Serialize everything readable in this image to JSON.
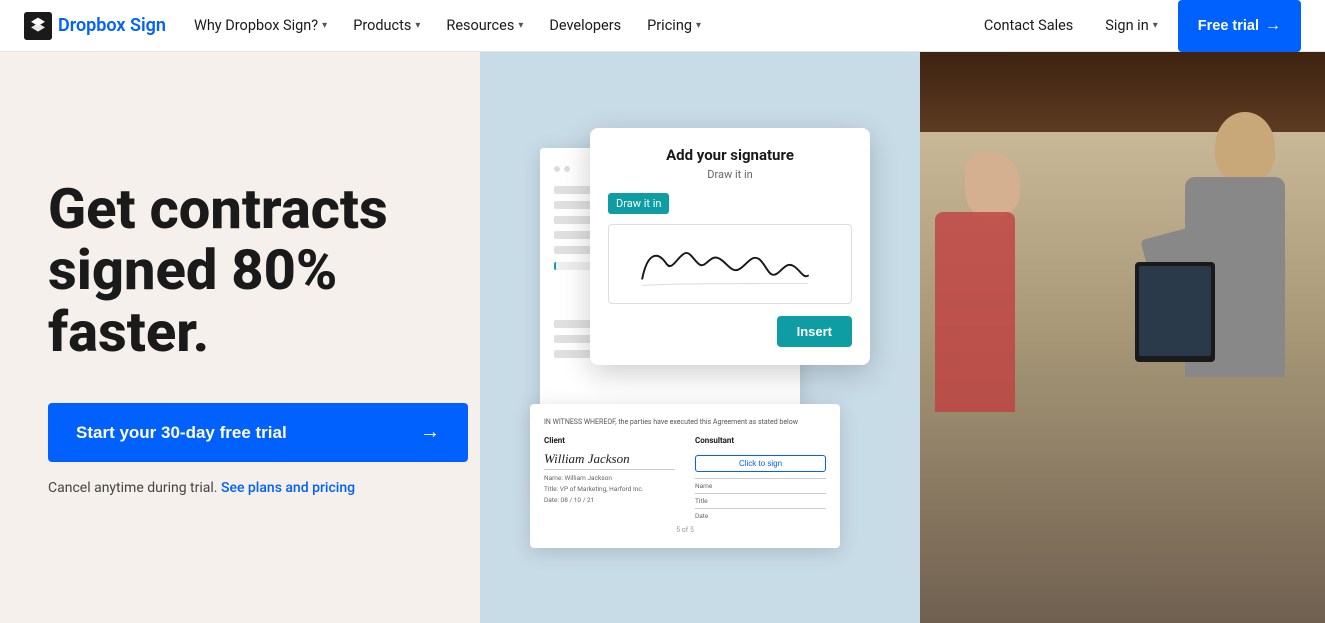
{
  "brand": {
    "name_part1": "Dropbox",
    "name_part2": "Sign"
  },
  "nav": {
    "items": [
      {
        "label": "Why Dropbox Sign?",
        "has_dropdown": true
      },
      {
        "label": "Products",
        "has_dropdown": true
      },
      {
        "label": "Resources",
        "has_dropdown": true
      },
      {
        "label": "Developers",
        "has_dropdown": false
      },
      {
        "label": "Pricing",
        "has_dropdown": true
      }
    ],
    "contact_sales": "Contact Sales",
    "sign_in": "Sign in",
    "free_trial": "Free trial"
  },
  "hero": {
    "headline": "Get contracts signed 80% faster.",
    "cta_label": "Start your 30-day free trial",
    "cancel_text": "Cancel anytime during trial.",
    "cancel_link": "See plans and pricing"
  },
  "signature_modal": {
    "title": "Add your signature",
    "subtitle": "Draw it in",
    "tab_draw": "Draw it in",
    "insert_btn": "Insert"
  },
  "doc_bottom": {
    "witness_text": "IN WITNESS WHEREOF, the parties have executed this Agreement as stated below",
    "client_label": "Client",
    "consultant_label": "Consultant",
    "client_sig": "William Jackson",
    "client_name_label": "Name: William Jackson",
    "client_title_label": "Title: VP of Marketing, Harford Inc.",
    "client_date_label": "Date: 08 / 10 / 21",
    "click_to_sign": "Click to sign",
    "page_num": "5 of 5"
  }
}
